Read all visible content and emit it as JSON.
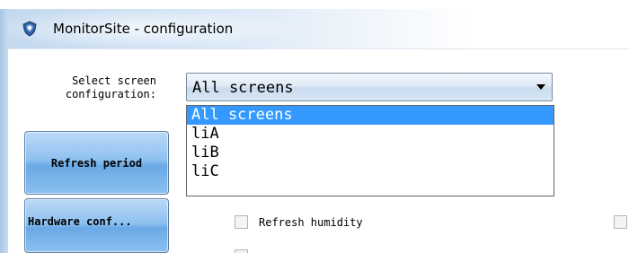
{
  "window": {
    "title": "MonitorSite - configuration",
    "icon": "app-shield-icon"
  },
  "screen_config": {
    "label": "Select screen configuration:",
    "selected_value": "All screens",
    "options": [
      "All screens",
      "liA",
      "liB",
      "liC"
    ],
    "highlighted_index": 0
  },
  "sidebar": {
    "buttons": [
      {
        "label": "Refresh period"
      },
      {
        "label": "Hardware conf..."
      }
    ]
  },
  "settings": {
    "refresh_humidity_label": "Refresh humidity",
    "refresh_humidity_checked": false
  },
  "colors": {
    "selection": "#3399ff",
    "button_blue": "#8ec1ef"
  }
}
